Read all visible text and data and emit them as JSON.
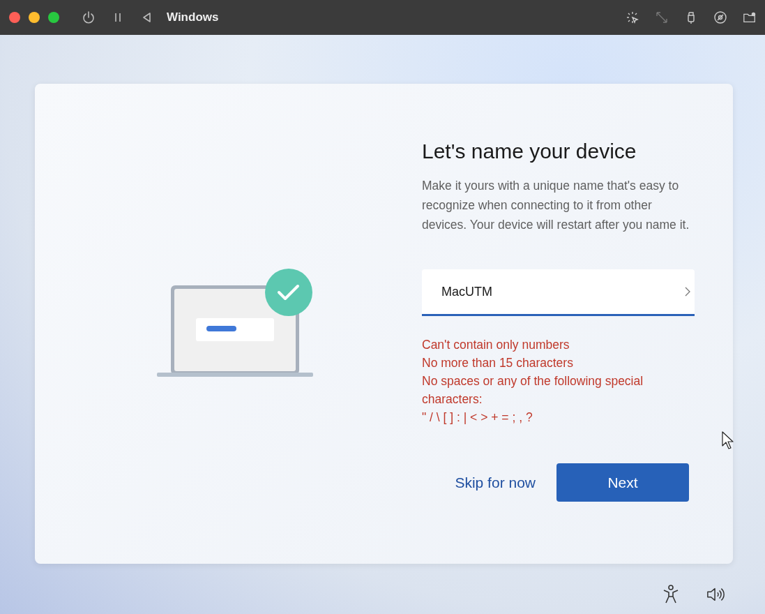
{
  "window": {
    "title": "Windows"
  },
  "dialog": {
    "heading": "Let's name your device",
    "description": "Make it yours with a unique name that's easy to recognize when connecting to it from other devices. Your device will restart after you name it.",
    "name_field": {
      "value": "MacUTM"
    },
    "errors": [
      "Can't contain only numbers",
      "No more than 15 characters",
      "No spaces or any of the following special characters:",
      "\" / \\ [ ] : | < > + = ; , ?"
    ],
    "secondary_button": "Skip for now",
    "primary_button": "Next"
  }
}
